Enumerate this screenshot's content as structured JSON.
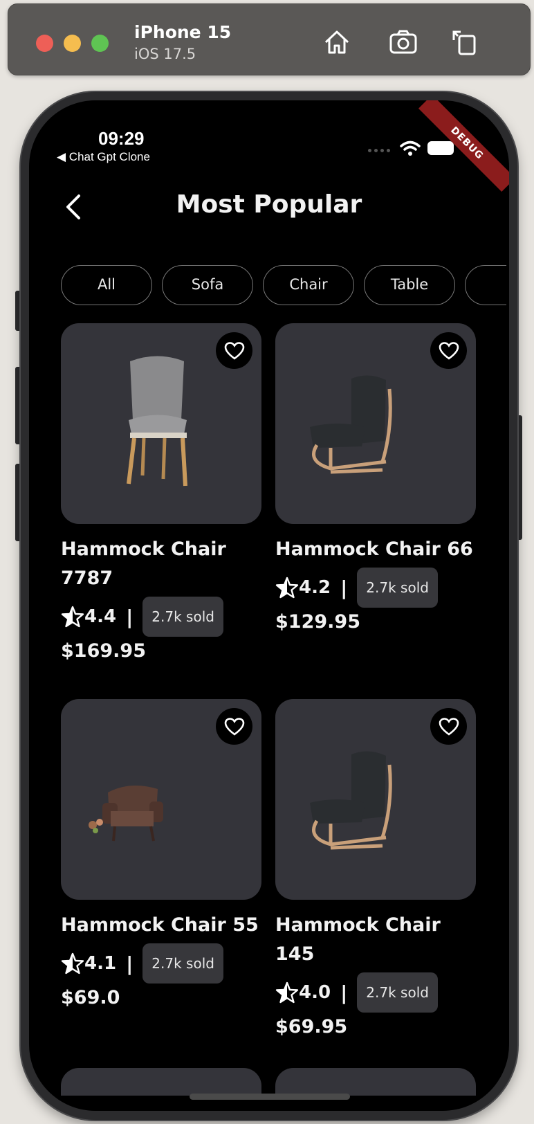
{
  "simulator": {
    "device": "iPhone 15",
    "os": "iOS 17.5",
    "icons": [
      "home-icon",
      "screenshot-icon",
      "rotate-icon"
    ]
  },
  "status_bar": {
    "time": "09:29",
    "back_app": "◀ Chat Gpt Clone",
    "debug": "DEBUG"
  },
  "header": {
    "title": "Most Popular"
  },
  "chips": [
    "All",
    "Sofa",
    "Chair",
    "Table",
    ""
  ],
  "products": [
    {
      "name": "Hammock Chair 7787",
      "rating": "4.4",
      "sold": "2.7k sold",
      "price": "$169.95",
      "image": "grey-dining-chair"
    },
    {
      "name": "Hammock Chair 66",
      "rating": "4.2",
      "sold": "2.7k sold",
      "price": "$129.95",
      "image": "black-lounge-chair"
    },
    {
      "name": "Hammock Chair 55",
      "rating": "4.1",
      "sold": "2.7k sold",
      "price": "$69.0",
      "image": "brown-armchair"
    },
    {
      "name": "Hammock Chair 145",
      "rating": "4.0",
      "sold": "2.7k sold",
      "price": "$69.95",
      "image": "black-lounge-chair"
    }
  ],
  "colors": {
    "background": "#000000",
    "card": "#34343a",
    "text": "#f2f2f2",
    "debug": "#8b1c1c"
  }
}
